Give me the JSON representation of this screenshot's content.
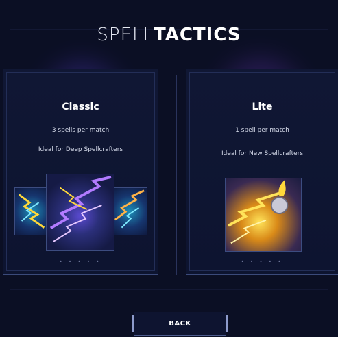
{
  "title": {
    "light": "SPELL",
    "bold": "TACTICS"
  },
  "modes": [
    {
      "name": "Classic",
      "line1": "3 spells per match",
      "line2": "Ideal for Deep Spellcrafters",
      "pager": "• • • • •"
    },
    {
      "name": "Lite",
      "line1": "1 spell per match",
      "line2": "Ideal for New Spellcrafters",
      "pager": "• • • • •"
    }
  ],
  "back_label": "BACK",
  "colors": {
    "background": "#0b0f24",
    "card_border": "#3b4a7a",
    "lightning_purple": "#b27bff",
    "lightning_yellow": "#ffd83a",
    "lightning_cyan": "#3ed8ff"
  }
}
